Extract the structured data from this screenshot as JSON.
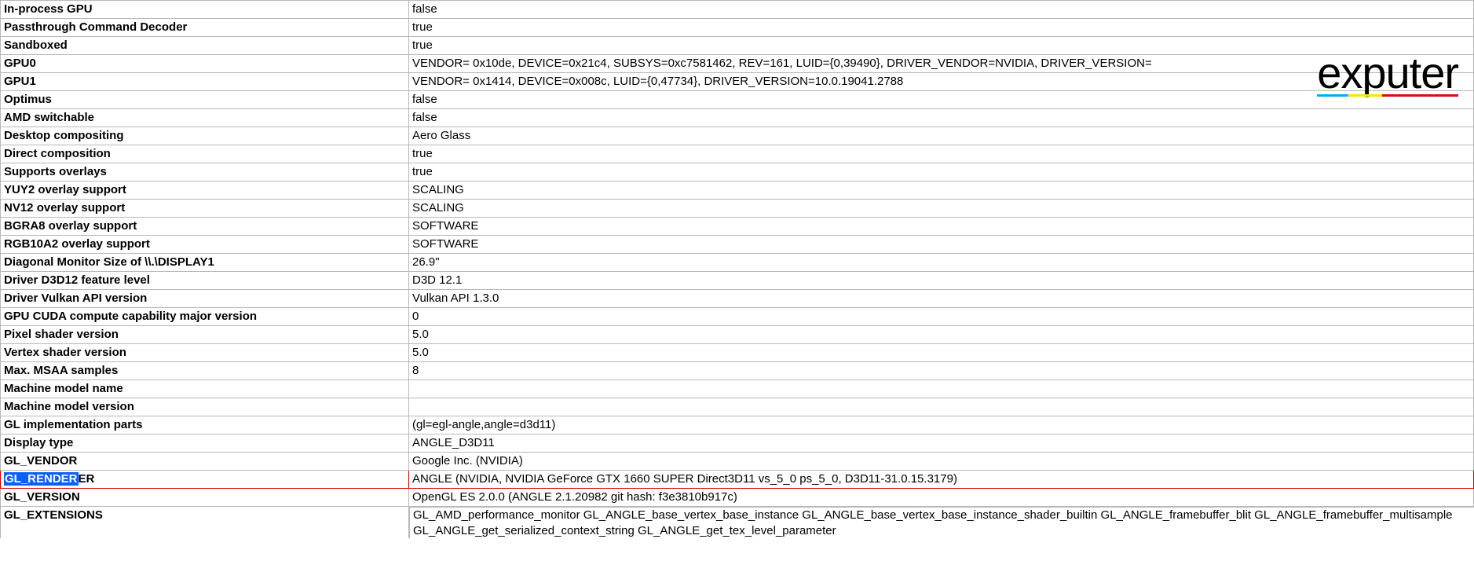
{
  "watermark": "exputer",
  "rows": [
    {
      "key": "In-process GPU",
      "val": "false"
    },
    {
      "key": "Passthrough Command Decoder",
      "val": "true"
    },
    {
      "key": "Sandboxed",
      "val": "true"
    },
    {
      "key": "GPU0",
      "val": "VENDOR= 0x10de, DEVICE=0x21c4, SUBSYS=0xc7581462, REV=161, LUID={0,39490}, DRIVER_VENDOR=NVIDIA, DRIVER_VERSION="
    },
    {
      "key": "GPU1",
      "val": "VENDOR= 0x1414, DEVICE=0x008c, LUID={0,47734}, DRIVER_VERSION=10.0.19041.2788"
    },
    {
      "key": "Optimus",
      "val": "false"
    },
    {
      "key": "AMD switchable",
      "val": "false"
    },
    {
      "key": "Desktop compositing",
      "val": "Aero Glass"
    },
    {
      "key": "Direct composition",
      "val": "true"
    },
    {
      "key": "Supports overlays",
      "val": "true"
    },
    {
      "key": "YUY2 overlay support",
      "val": "SCALING"
    },
    {
      "key": "NV12 overlay support",
      "val": "SCALING"
    },
    {
      "key": "BGRA8 overlay support",
      "val": "SOFTWARE"
    },
    {
      "key": "RGB10A2 overlay support",
      "val": "SOFTWARE"
    },
    {
      "key": "Diagonal Monitor Size of \\\\.\\DISPLAY1",
      "val": "26.9\""
    },
    {
      "key": "Driver D3D12 feature level",
      "val": "D3D 12.1"
    },
    {
      "key": "Driver Vulkan API version",
      "val": "Vulkan API 1.3.0"
    },
    {
      "key": "GPU CUDA compute capability major version",
      "val": "0"
    },
    {
      "key": "Pixel shader version",
      "val": "5.0"
    },
    {
      "key": "Vertex shader version",
      "val": "5.0"
    },
    {
      "key": "Max. MSAA samples",
      "val": "8"
    },
    {
      "key": "Machine model name",
      "val": ""
    },
    {
      "key": "Machine model version",
      "val": ""
    },
    {
      "key": "GL implementation parts",
      "val": "(gl=egl-angle,angle=d3d11)"
    },
    {
      "key": "Display type",
      "val": "ANGLE_D3D11"
    },
    {
      "key": "GL_VENDOR",
      "val": "Google Inc. (NVIDIA)"
    },
    {
      "key_sel": "GL_RENDER",
      "key_rest": "ER",
      "val": "ANGLE (NVIDIA, NVIDIA GeForce GTX 1660 SUPER Direct3D11 vs_5_0 ps_5_0, D3D11-31.0.15.3179)",
      "highlight": true
    },
    {
      "key": "GL_VERSION",
      "val": "OpenGL ES 2.0.0 (ANGLE 2.1.20982 git hash: f3e3810b917c)"
    },
    {
      "key": "GL_EXTENSIONS",
      "val": "GL_AMD_performance_monitor GL_ANGLE_base_vertex_base_instance GL_ANGLE_base_vertex_base_instance_shader_builtin GL_ANGLE_framebuffer_blit GL_ANGLE_framebuffer_multisample GL_ANGLE_get_serialized_context_string GL_ANGLE_get_tex_level_parameter",
      "last": true
    }
  ]
}
